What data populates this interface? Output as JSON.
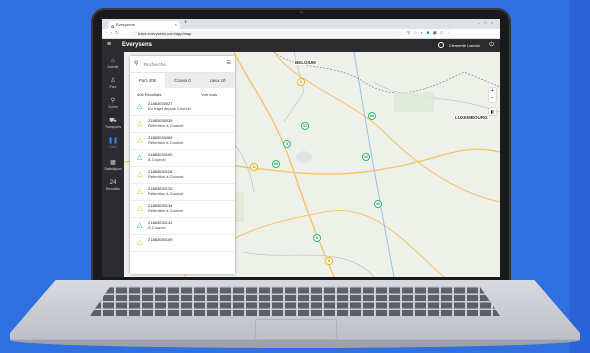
{
  "browser": {
    "tab_title": "Everysens",
    "url": "track.everysens.com/app/map"
  },
  "app": {
    "brand": "Everysens",
    "user_name": "Clemente Lacroix",
    "brand_color": "#2c2c30",
    "accent": "#2e8fff"
  },
  "sidebar": {
    "items": [
      {
        "icon": "home-icon",
        "label": "Activité",
        "glyph": "⌂"
      },
      {
        "icon": "person-icon",
        "label": "Parc",
        "glyph": "♙"
      },
      {
        "icon": "zone-icon",
        "label": "Zones",
        "glyph": "⚲"
      },
      {
        "icon": "truck-icon",
        "label": "Transports",
        "glyph": "⛟"
      },
      {
        "icon": "pause-icon",
        "label": "Carte",
        "glyph": "❚❚"
      },
      {
        "icon": "stats-icon",
        "label": "Statistiques",
        "glyph": "▦"
      },
      {
        "icon": "time-icon",
        "label": "Résultats",
        "glyph": "24"
      }
    ]
  },
  "panel": {
    "search_placeholder": "Recherche",
    "tabs": [
      "Parc 406",
      "Convoi 0",
      "Lieux 10"
    ],
    "count": "406 Résultats",
    "sort_label": "Voir tous",
    "rows": [
      {
        "id": "21883030027",
        "status": "En trajet depuis Courcel",
        "color": "g"
      },
      {
        "id": "21883030035",
        "status": "Rétention à Courcel",
        "color": "y"
      },
      {
        "id": "21883030068",
        "status": "Rétention à Courcel",
        "color": "y"
      },
      {
        "id": "21883030100",
        "status": "À Courcel",
        "color": "g"
      },
      {
        "id": "21883030118",
        "status": "Rétention à Courcel",
        "color": "y"
      },
      {
        "id": "21883030126",
        "status": "Rétention à Courcel",
        "color": "y"
      },
      {
        "id": "21883030134",
        "status": "Rétention à Courcel",
        "color": "y"
      },
      {
        "id": "21883030142",
        "status": "À Courcel",
        "color": "g"
      },
      {
        "id": "21883030159",
        "status": "",
        "color": "y"
      }
    ]
  },
  "map": {
    "labels": {
      "belgium": "BELGIUM",
      "luxembourg": "LUXEMBOURG"
    },
    "clusters": [
      {
        "value": "6",
        "color": "y"
      },
      {
        "value": "31",
        "color": "g"
      },
      {
        "value": "5",
        "color": "g"
      },
      {
        "value": "85",
        "color": "g"
      },
      {
        "value": "11",
        "color": "y"
      },
      {
        "value": "66",
        "color": "g"
      },
      {
        "value": "10",
        "color": "g"
      },
      {
        "value": "35",
        "color": "g"
      },
      {
        "value": "8",
        "color": "g"
      },
      {
        "value": "5",
        "color": "y"
      }
    ]
  }
}
